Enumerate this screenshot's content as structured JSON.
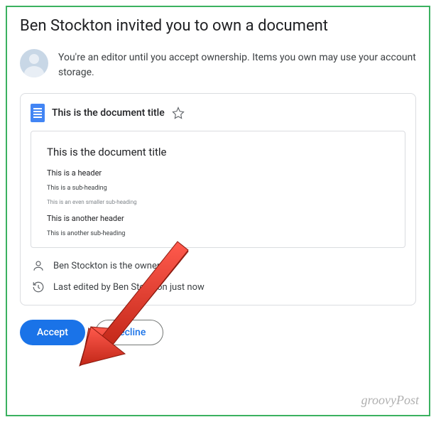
{
  "title": "Ben Stockton invited you to own a document",
  "info_text": "You're an editor until you accept ownership. Items you own may use your account storage.",
  "document": {
    "title": "This is the document title",
    "preview": {
      "title": "This is the document title",
      "header1": "This is a header",
      "sub1": "This is a sub-heading",
      "sub2": "This is an even smaller sub-heading",
      "header2": "This is another header",
      "sub3": "This is another sub-heading"
    },
    "owner_text": "Ben Stockton is the owner",
    "edited_text": "Last edited by Ben Stockton just now"
  },
  "buttons": {
    "accept": "Accept",
    "decline": "Decline"
  },
  "watermark": "groovyPost"
}
